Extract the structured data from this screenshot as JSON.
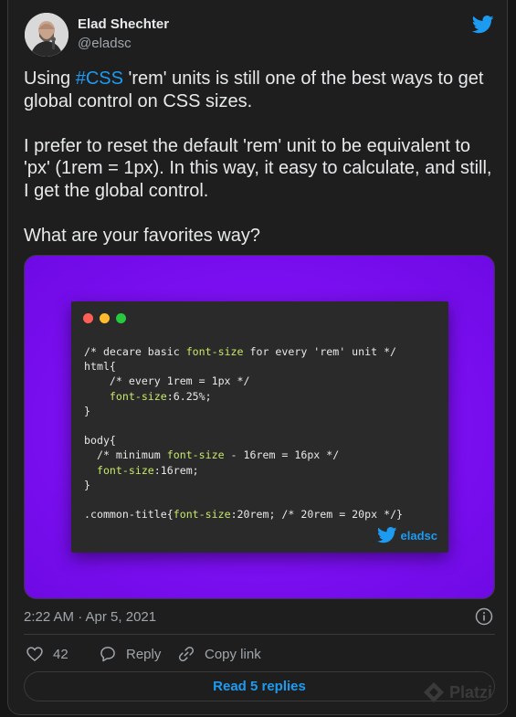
{
  "author": {
    "name": "Elad Shechter",
    "handle": "@eladsc"
  },
  "tweet": {
    "line1_pre": "Using ",
    "hashtag": "#CSS",
    "line1_post": " 'rem' units is still one of the best ways to get global control on CSS sizes.",
    "paragraph2": "I prefer to reset the default 'rem' unit to be equivalent to 'px'  (1rem = 1px). In this way, it easy to calculate, and still, I get the global control.",
    "paragraph3": "What are your favorites way?"
  },
  "media": {
    "code_lines": [
      "/* decare basic font-size for every 'rem' unit */",
      "html{",
      "    /* every 1rem = 1px */",
      "    font-size:6.25%;",
      "}",
      "",
      "body{",
      "  /* minimum font-size - 16rem = 16px */",
      "  font-size:16rem;",
      "}",
      "",
      ".common-title{font-size:20rem; /* 20rem = 20px */}"
    ],
    "brand": "eladsc",
    "window_dots": [
      "#ff5f56",
      "#ffbd2e",
      "#27c93f"
    ]
  },
  "meta": {
    "timestamp": "2:22 AM · Apr 5, 2021"
  },
  "actions": {
    "like_count": "42",
    "reply_label": "Reply",
    "copy_label": "Copy link"
  },
  "replies_button": "Read 5 replies",
  "watermark": "Platzi",
  "colors": {
    "accent": "#1d9bf0",
    "media_bg": "#8b10f7",
    "code_property": "#c7e86a"
  }
}
